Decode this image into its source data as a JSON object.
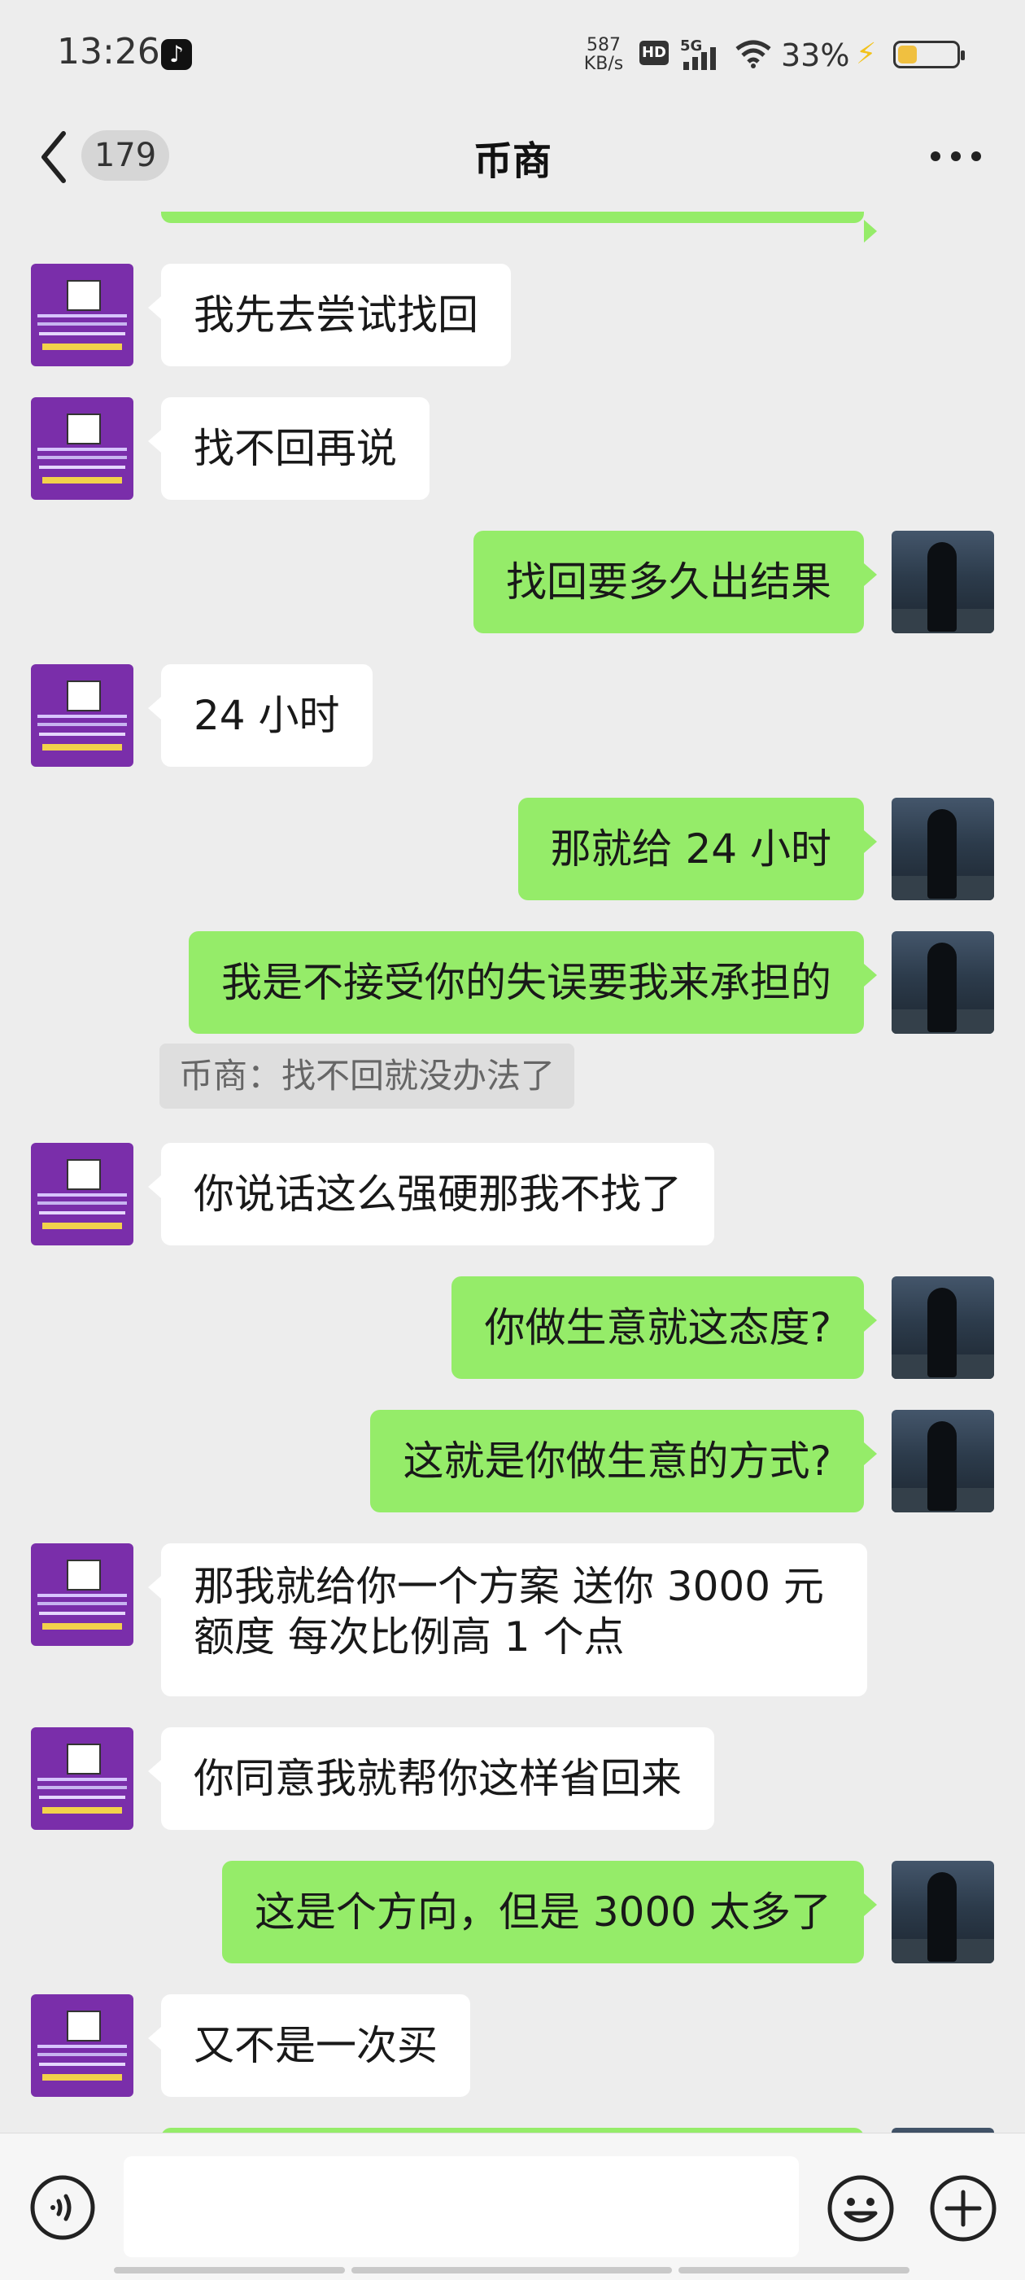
{
  "status_bar": {
    "time": "13:26",
    "tiktok_icon": "♪",
    "net_speed_value": "587",
    "net_speed_unit": "KB/s",
    "hd_label": "HD",
    "signal_label": "5G",
    "battery_percent": "33%",
    "battery_level": 0.33,
    "charging_bolt": "⚡"
  },
  "header": {
    "unread_count": "179",
    "title": "币商"
  },
  "messages": [
    {
      "from": "other",
      "text": "我先去尝试找回"
    },
    {
      "from": "other",
      "text": "找不回再说"
    },
    {
      "from": "me",
      "text": "找回要多久出结果"
    },
    {
      "from": "other",
      "text": "24 小时"
    },
    {
      "from": "me",
      "text": "那就给 24 小时"
    },
    {
      "from": "me",
      "text": "我是不接受你的失误要我来承担的"
    },
    {
      "from": "quote",
      "text": "币商：找不回就没办法了"
    },
    {
      "from": "other",
      "text": "你说话这么强硬那我不找了"
    },
    {
      "from": "me",
      "text": "你做生意就这态度?"
    },
    {
      "from": "me",
      "text": "这就是你做生意的方式?"
    },
    {
      "from": "other",
      "text": "那我就给你一个方案 送你 3000 元额度 每次比例高 1 个点"
    },
    {
      "from": "other",
      "text": "你同意我就帮你这样省回来"
    },
    {
      "from": "me",
      "text": "这是个方向，但是 3000 太多了"
    },
    {
      "from": "other",
      "text": "又不是一次买"
    }
  ],
  "colors": {
    "background": "#ededed",
    "my_bubble": "#95ec69",
    "other_bubble": "#ffffff",
    "quote_bg": "#dedede"
  },
  "icons": {
    "back": "chevron-left-icon",
    "more": "more-dots-icon",
    "voice": "voice-icon",
    "emoji": "emoji-icon",
    "plus": "plus-icon"
  }
}
